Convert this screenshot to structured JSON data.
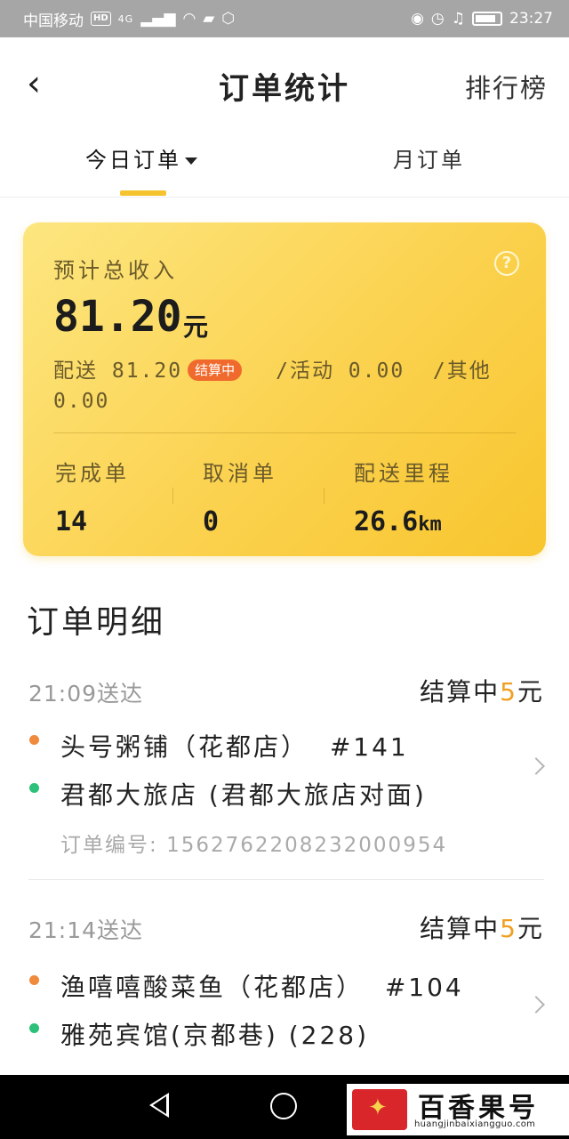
{
  "status_bar": {
    "carrier": "中国移动",
    "hd": "HD",
    "signal": "4G",
    "time": "23:27"
  },
  "header": {
    "title": "订单统计",
    "ranking_label": "排行榜"
  },
  "tabs": {
    "today": "今日订单",
    "month": "月订单"
  },
  "income_card": {
    "label": "预计总收入",
    "help_glyph": "?",
    "total_amount": "81.20",
    "total_unit": "元",
    "delivery": "配送 81.20",
    "settle_badge": "结算中",
    "activity": "/活动 0.00",
    "other": "/其他 0.00",
    "stats": [
      {
        "label": "完成单",
        "value": "14",
        "unit": ""
      },
      {
        "label": "取消单",
        "value": "0",
        "unit": ""
      },
      {
        "label": "配送里程",
        "value": "26.6",
        "unit": "km"
      }
    ]
  },
  "details": {
    "title": "订单明细",
    "orders": [
      {
        "time": "21:09送达",
        "status_prefix": "结算中",
        "amount": "5",
        "amount_unit": "元",
        "pickup": "头号粥铺（花都店）",
        "pickup_no": "#141",
        "dropoff": "君都大旅店 (君都大旅店对面)",
        "order_no_label": "订单编号:",
        "order_no": "1562762208232000954"
      },
      {
        "time": "21:14送达",
        "status_prefix": "结算中",
        "amount": "5",
        "amount_unit": "元",
        "pickup": "渔嘻嘻酸菜鱼（花都店）",
        "pickup_no": "#104",
        "dropoff": "雅苑宾馆(京都巷) (228)"
      }
    ]
  },
  "watermark": {
    "title": "百香果号",
    "url": "huangjinbaixiangguo.com"
  }
}
